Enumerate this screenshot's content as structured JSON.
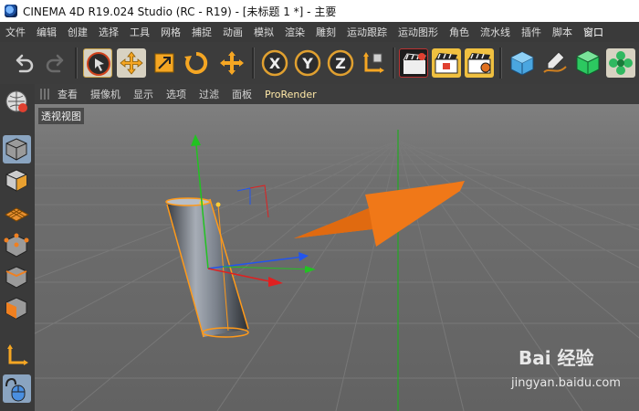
{
  "window": {
    "title": "CINEMA 4D R19.024 Studio (RC - R19) - [未标题 1 *] - 主要"
  },
  "menubar": {
    "items": [
      "文件",
      "编辑",
      "创建",
      "选择",
      "工具",
      "网格",
      "捕捉",
      "动画",
      "模拟",
      "渲染",
      "雕刻",
      "运动跟踪",
      "运动图形",
      "角色",
      "流水线",
      "插件",
      "脚本",
      "窗口"
    ]
  },
  "toolbar": {
    "icons": [
      "undo-icon",
      "redo-icon",
      "live-select-icon",
      "move-icon",
      "scale-icon",
      "rotate-icon",
      "recent-tools-icon",
      "x-axis-lock-icon",
      "y-axis-lock-icon",
      "z-axis-lock-icon",
      "coordinate-system-icon",
      "render-view-icon",
      "render-to-picture-viewer-icon",
      "render-settings-icon",
      "cube-icon",
      "pen-spline-icon",
      "subdivision-icon",
      "cloner-icon"
    ],
    "axis_labels": [
      "X",
      "Y",
      "Z"
    ]
  },
  "view_menu": {
    "items": [
      "查看",
      "摄像机",
      "显示",
      "选项",
      "过滤",
      "面板",
      "ProRender"
    ],
    "active": "ProRender"
  },
  "viewport": {
    "label": "透视视图",
    "colors": {
      "x_axis": "#e02020",
      "y_axis": "#22c222",
      "z_axis": "#2255ee",
      "selection": "#ff9a1a",
      "arrow": "#f07818",
      "background": "#6e6e6e"
    }
  },
  "leftbar": {
    "icons": [
      "make-editable-icon",
      "model-mode-icon",
      "texture-mode-icon",
      "workplane-icon",
      "points-mode-icon",
      "edges-mode-icon",
      "polygons-mode-icon",
      "axis-mode-icon",
      "tweak-mode-icon"
    ]
  },
  "watermark": {
    "logo": "Bai 经验",
    "url": "jingyan.baidu.com"
  }
}
